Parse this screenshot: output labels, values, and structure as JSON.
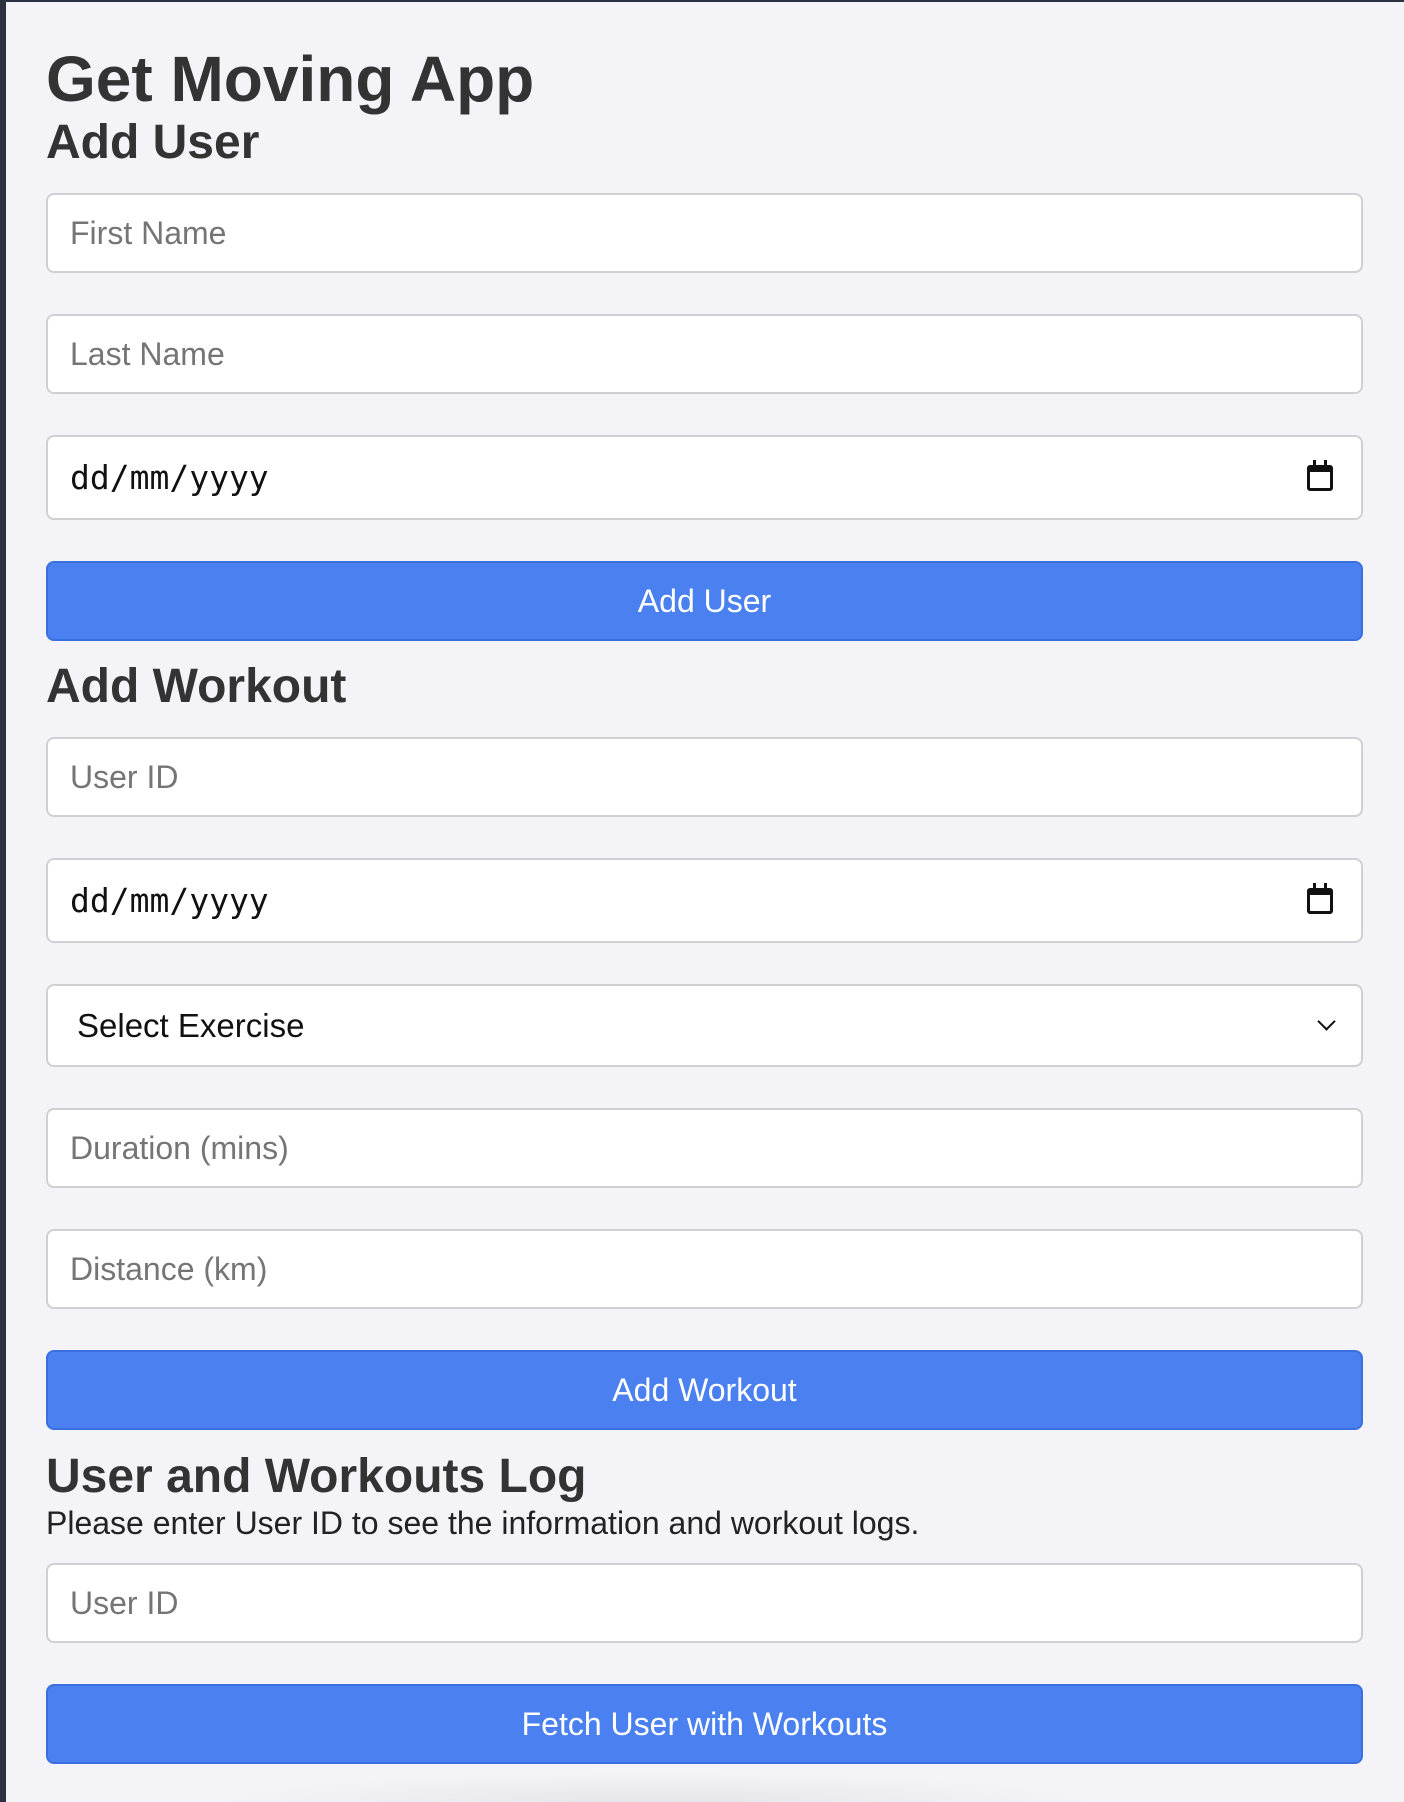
{
  "app": {
    "title": "Get Moving App"
  },
  "add_user": {
    "heading": "Add User",
    "first_name_placeholder": "First Name",
    "last_name_placeholder": "Last Name",
    "date_placeholder": "dd/mm/yyyy",
    "button_label": "Add User"
  },
  "add_workout": {
    "heading": "Add Workout",
    "user_id_placeholder": "User ID",
    "date_placeholder": "dd/mm/yyyy",
    "exercise_selected": "Select Exercise",
    "duration_placeholder": "Duration (mins)",
    "distance_placeholder": "Distance (km)",
    "button_label": "Add Workout"
  },
  "log": {
    "heading": "User and Workouts Log",
    "description": "Please enter User ID to see the information and workout logs.",
    "user_id_placeholder": "User ID",
    "button_label": "Fetch User with Workouts"
  },
  "colors": {
    "button_bg": "#4a80f0",
    "page_bg": "#f4f4f8",
    "text": "#333333"
  },
  "icons": {
    "date_picker": "calendar-icon",
    "select_dropdown": "chevron-down-icon"
  }
}
